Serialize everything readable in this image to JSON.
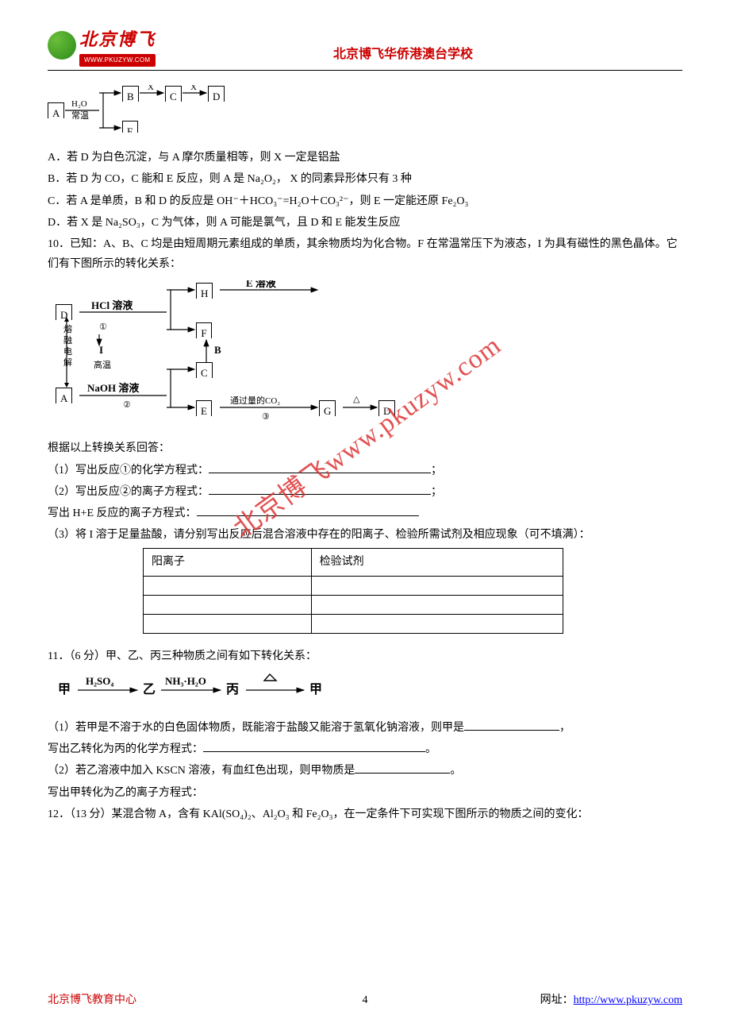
{
  "logo": {
    "cn": "北京博飞",
    "url": "WWW.PKUZYW.COM"
  },
  "school": "北京博飞华侨港澳台学校",
  "watermark": "北京博飞www.pkuzyw.com",
  "d1": {
    "A": "A",
    "B": "B",
    "C": "C",
    "D": "D",
    "E": "E",
    "h2o": "H₂O",
    "temp": "常温",
    "x1": "X",
    "x2": "X"
  },
  "q9": {
    "a": "A．若 D 为白色沉淀，与 A 摩尔质量相等，则 X 一定是铝盐",
    "b": "B．若 D 为 CO，C 能和 E 反应，则 A 是 Na₂O₂， X 的同素异形体只有 3 种",
    "c": "C．若 A 是单质，B 和 D 的反应是 OH⁻＋HCO₃⁻=H₂O＋CO₃²⁻，则 E 一定能还原 Fe₂O₃",
    "d": "D．若 X 是 Na₂SO₃，C 为气体，则 A 可能是氯气，且 D 和 E 能发生反应"
  },
  "q10": {
    "stem": "10．已知：A、B、C 均是由短周期元素组成的单质，其余物质均为化合物。F 在常温常压下为液态，I 为具有磁性的黑色晶体。它们有下图所示的转化关系：",
    "d2": {
      "A": "A",
      "D": "D",
      "H": "H",
      "F": "F",
      "C": "C",
      "E": "E",
      "G": "G",
      "D2": "D",
      "hcl": "HCl 溶液",
      "naoh": "NaOH 溶液",
      "esol": "E 溶液",
      "B": "B",
      "I": "I",
      "hi": "高温",
      "co2": "通过量的CO₂",
      "c1": "①",
      "c2": "②",
      "c3": "③",
      "tri": "△",
      "melt": "熔融电解"
    },
    "sub": "根据以上转换关系回答：",
    "p1": "（1）写出反应①的化学方程式：",
    "p2": "（2）写出反应②的离子方程式：",
    "p2b": "写出 H+E 反应的离子方程式：",
    "p3": "（3）将 I 溶于足量盐酸，请分别写出反应后混合溶液中存在的阳离子、检验所需试剂及相应现象（可不填满）：",
    "th1": "阳离子",
    "th2": "检验试剂"
  },
  "q11": {
    "stem": "11．（6 分）甲、乙、丙三种物质之间有如下转化关系：",
    "eq": {
      "jia": "甲",
      "yi": "乙",
      "bing": "丙",
      "jia2": "甲",
      "r1": "H₂SO₄",
      "r2": "NH₃·H₂O",
      "tri": "△"
    },
    "p1a": "（1）若甲是不溶于水的白色固体物质，既能溶于盐酸又能溶于氢氧化钠溶液，则甲是",
    "p1b": "，",
    "p1c": "写出乙转化为丙的化学方程式：",
    "p1d": "。",
    "p2a": "（2）若乙溶液中加入 KSCN 溶液，有血红色出现，则甲物质是",
    "p2b": "。",
    "p2c": "写出甲转化为乙的离子方程式："
  },
  "q12": {
    "stem": "12．（13 分）某混合物 A，含有 KAl(SO₄)₂、Al₂O₃ 和 Fe₂O₃，在一定条件下可实现下图所示的物质之间的变化："
  },
  "footer": {
    "left": "北京博飞教育中心",
    "page": "4",
    "rlabel": "网址：",
    "url": "http://www.pkuzyw.com"
  }
}
